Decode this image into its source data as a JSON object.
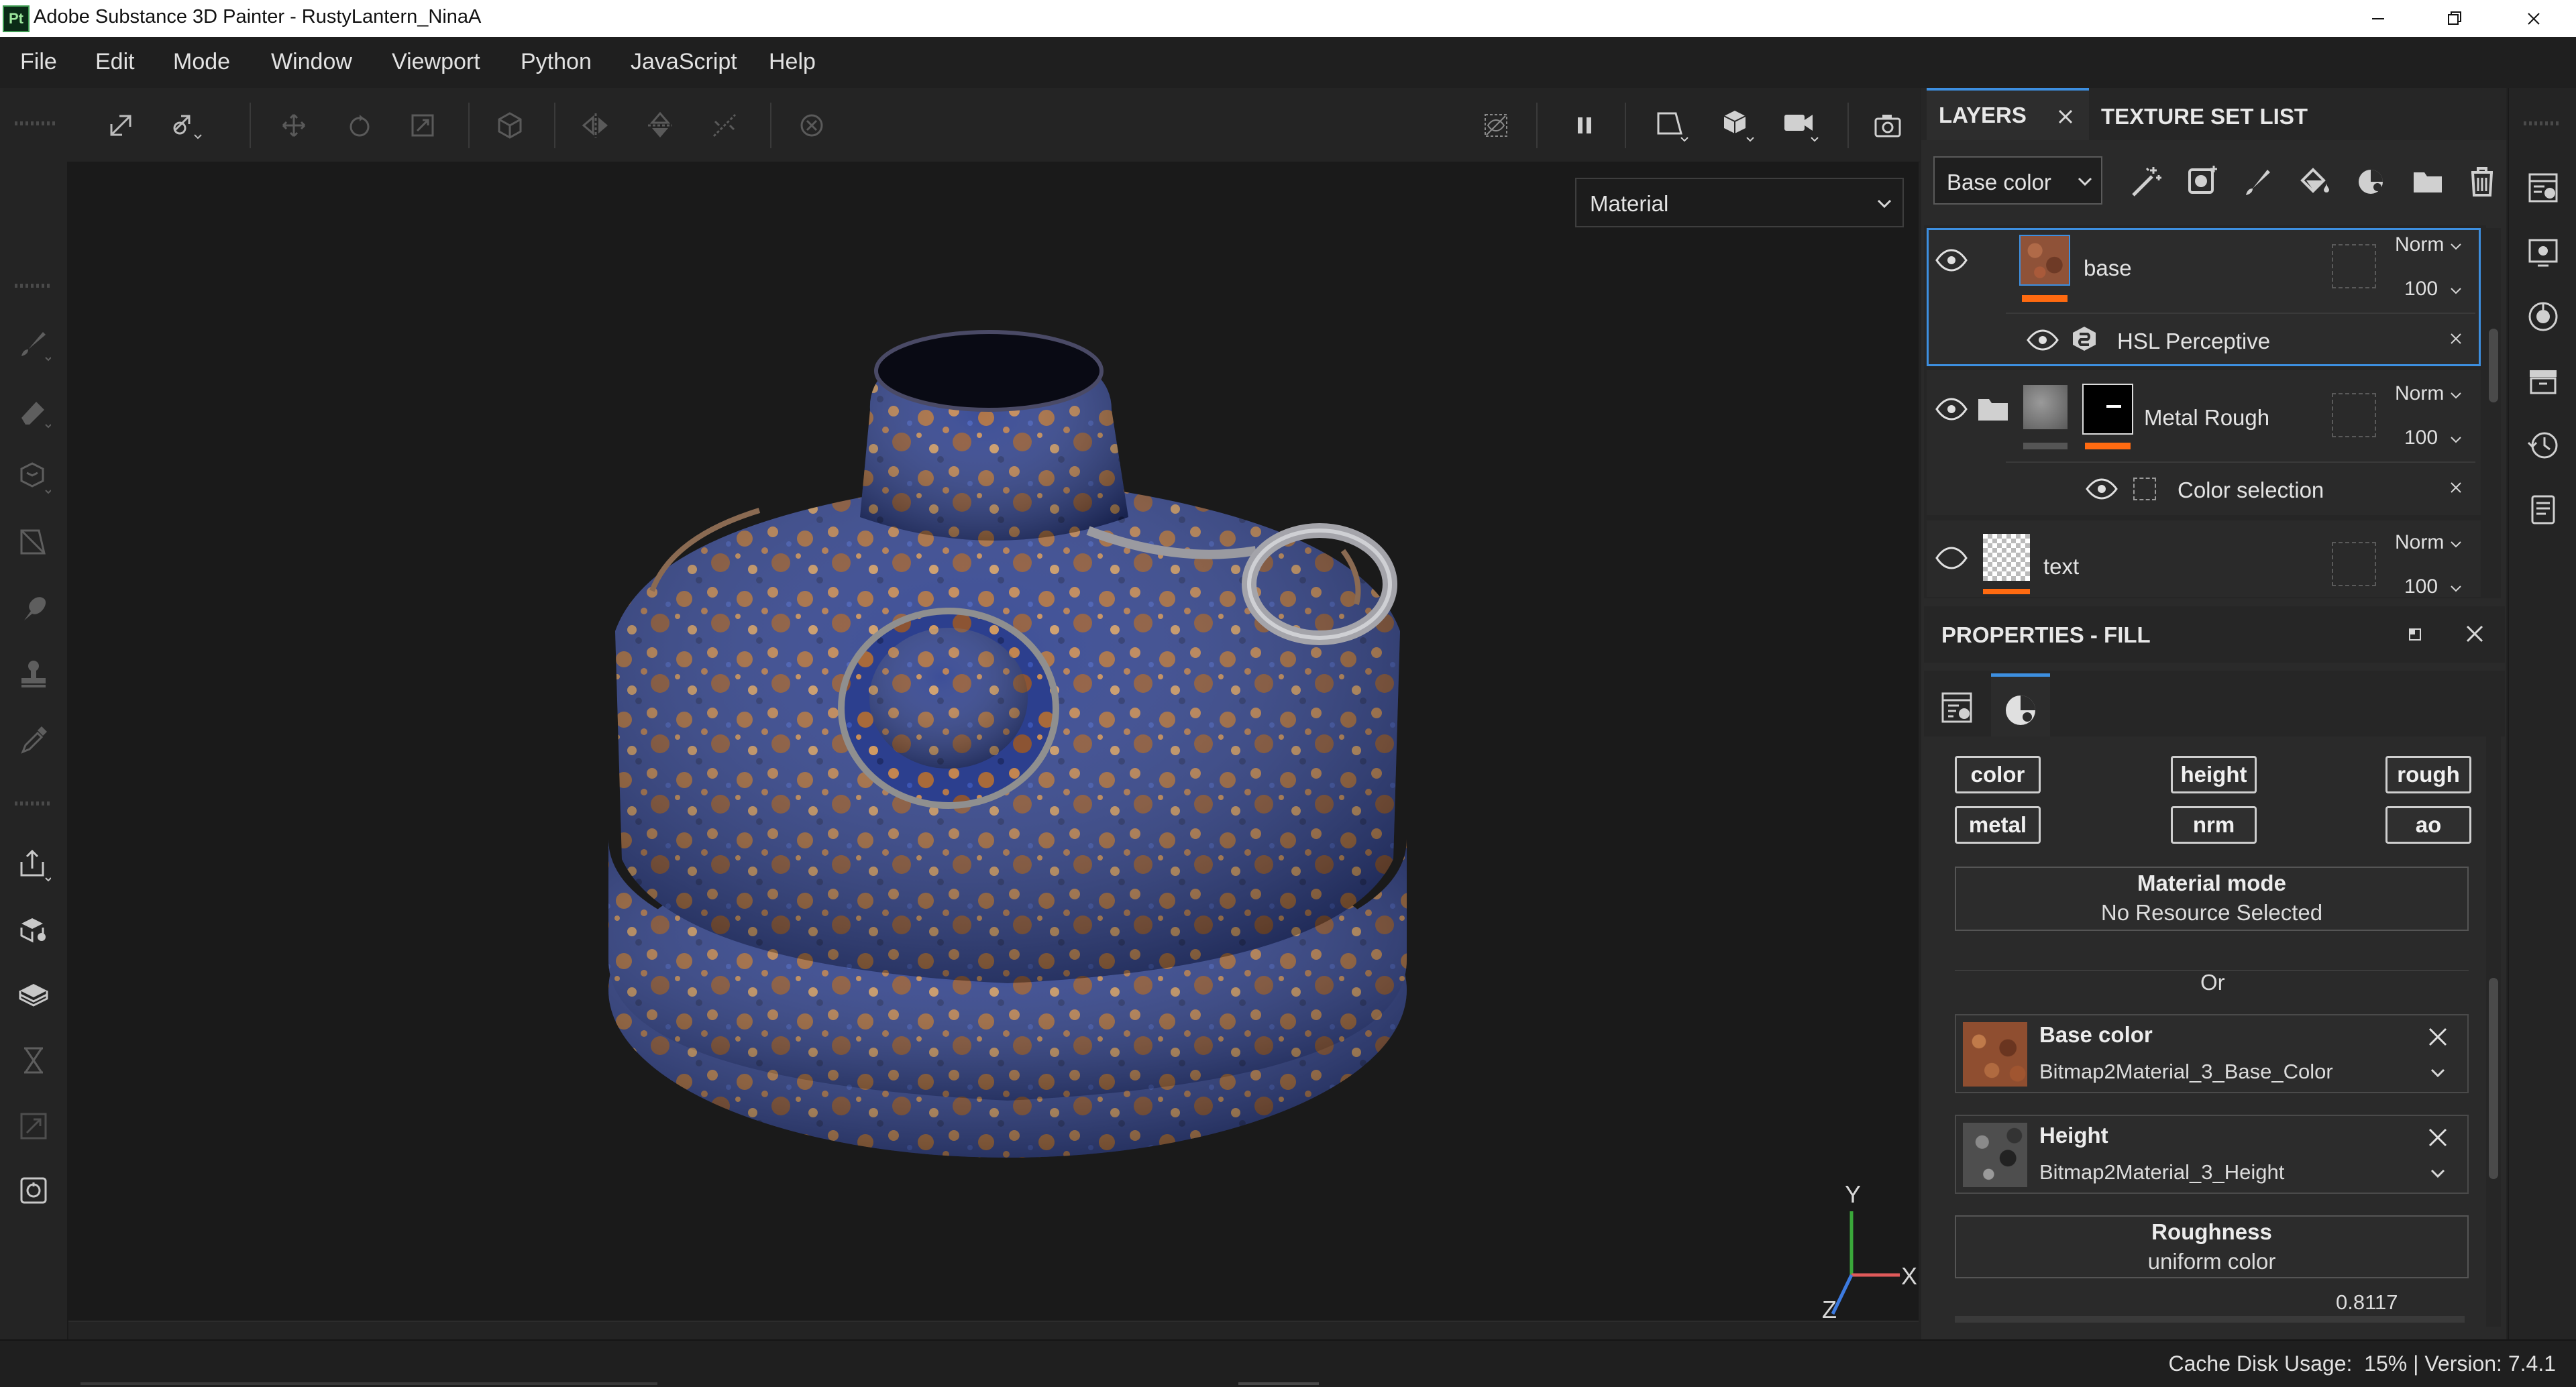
{
  "window": {
    "title": "Adobe Substance 3D Painter - RustyLantern_NinaA",
    "logo": "Pt"
  },
  "menu": [
    "File",
    "Edit",
    "Mode",
    "Window",
    "Viewport",
    "Python",
    "JavaScript",
    "Help"
  ],
  "viewport": {
    "display_mode": "Material",
    "axis_labels": {
      "y": "Y",
      "x": "X",
      "z": "Z"
    }
  },
  "layers_panel": {
    "tab_layers": "LAYERS",
    "tab_texture_set_list": "TEXTURE SET LIST",
    "channel": "Base color",
    "layers": [
      {
        "name": "base",
        "blend": "Norm",
        "opacity": "100",
        "effect": "HSL Perceptive"
      },
      {
        "name": "Metal Rough",
        "blend": "Norm",
        "opacity": "100",
        "effect": "Color selection"
      },
      {
        "name": "text",
        "blend": "Norm",
        "opacity": "100"
      }
    ]
  },
  "properties": {
    "title": "PROPERTIES - FILL",
    "channel_buttons": [
      "color",
      "height",
      "rough",
      "metal",
      "nrm",
      "ao"
    ],
    "material_mode_label": "Material mode",
    "material_mode_value": "No Resource Selected",
    "or_label": "Or",
    "slots": [
      {
        "label": "Base color",
        "resource": "Bitmap2Material_3_Base_Color"
      },
      {
        "label": "Height",
        "resource": "Bitmap2Material_3_Height"
      }
    ],
    "roughness_label": "Roughness",
    "roughness_mode": "uniform color",
    "roughness_value": "0.8117"
  },
  "status": {
    "text": "Cache Disk Usage:  15% | Version: 7.4.1"
  },
  "colors": {
    "accent_blue": "#3d8fe0",
    "accent_orange": "#ff6a10",
    "model_blue": "#2a3d8a",
    "model_rust": "#b0703a"
  }
}
